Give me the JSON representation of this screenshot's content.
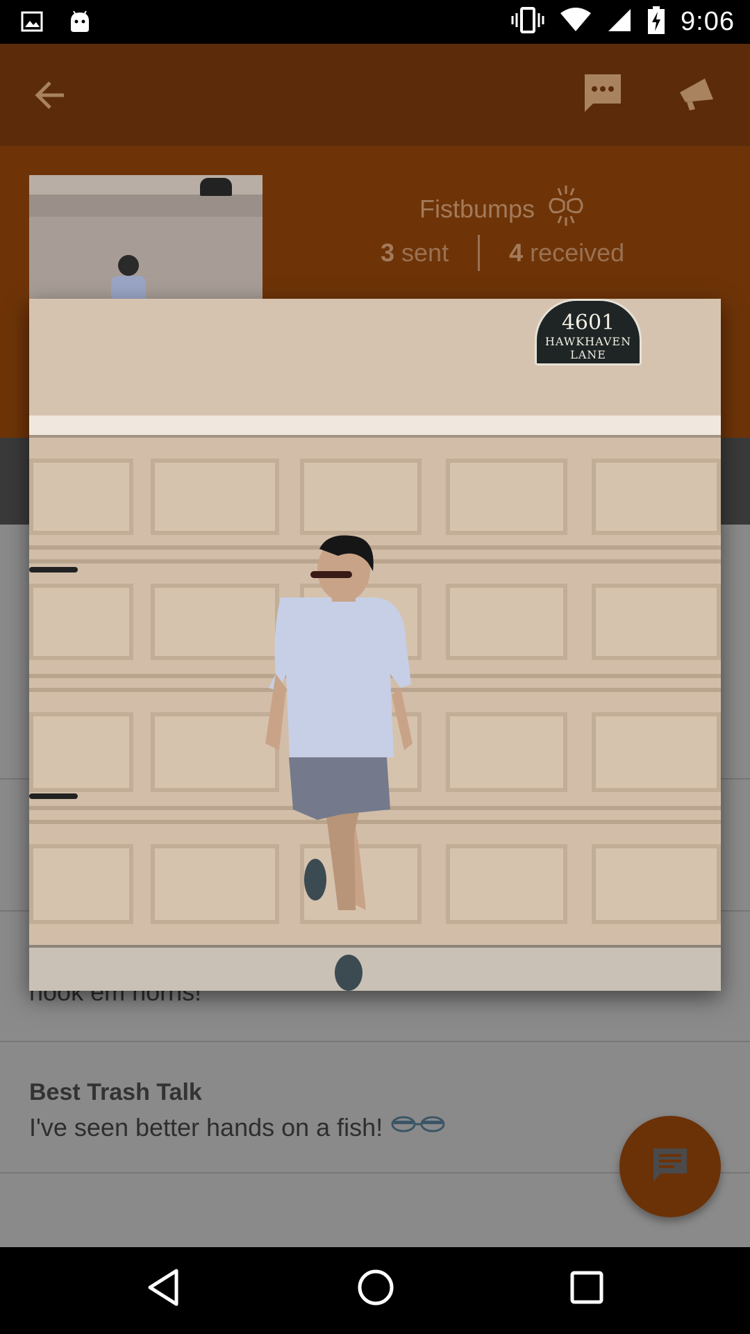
{
  "status_bar": {
    "time": "9:06"
  },
  "profile": {
    "fistbumps_label": "Fistbumps",
    "sent_count": "3",
    "sent_label": "sent",
    "received_count": "4",
    "received_label": "received"
  },
  "list": {
    "partial_text": "hook em horns!",
    "items": [
      {
        "title": "Best Trash Talk",
        "text": "I've seen better hands on a fish!"
      }
    ]
  },
  "photo": {
    "sign_number": "4601",
    "sign_street": "HAWKHAVEN LANE"
  },
  "colors": {
    "primary_dark": "#5c2c0a",
    "primary": "#6e3408",
    "accent_fab": "#6b3208"
  }
}
